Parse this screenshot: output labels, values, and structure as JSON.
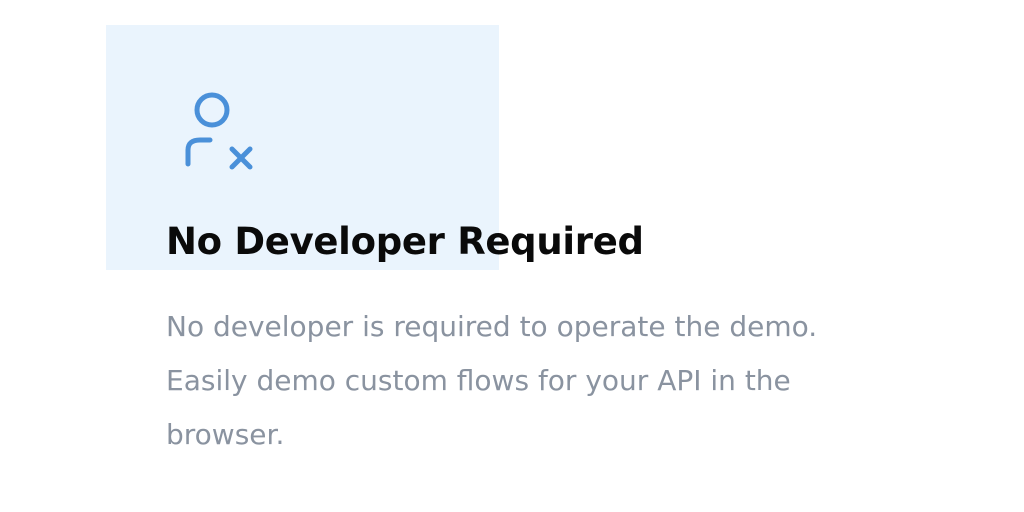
{
  "feature": {
    "icon": "user-remove-icon",
    "title": "No Developer Required",
    "description_lines": [
      "No developer is required to operate the demo.",
      "Easily demo custom flows for your API in the",
      "browser."
    ]
  },
  "colors": {
    "highlight_background": "#eaf4fd",
    "icon": "#4a90d9",
    "title": "#0a0a0a",
    "description": "#8a93a0"
  }
}
